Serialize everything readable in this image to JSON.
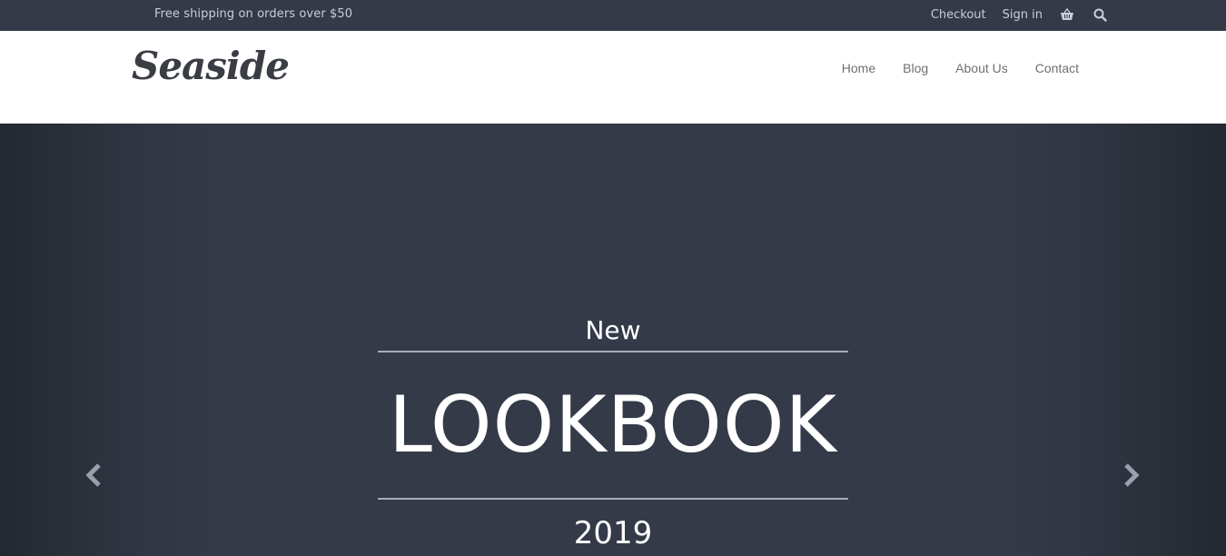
{
  "topbar": {
    "promo": "Free shipping on orders over $50",
    "checkout": "Checkout",
    "signin": "Sign in",
    "cart_icon": "basket-icon",
    "search_icon": "search-icon"
  },
  "header": {
    "logo": "Seaside",
    "nav": [
      "Home",
      "Blog",
      "About Us",
      "Contact"
    ]
  },
  "hero": {
    "kicker": "New",
    "title": "LOOKBOOK",
    "year": "2019",
    "prev_icon": "chevron-left-icon",
    "next_icon": "chevron-right-icon"
  },
  "colors": {
    "topbar_bg": "#343a48",
    "hero_bg": "#343a48",
    "text_light": "#ffffff",
    "nav_text": "#6d6f73"
  }
}
